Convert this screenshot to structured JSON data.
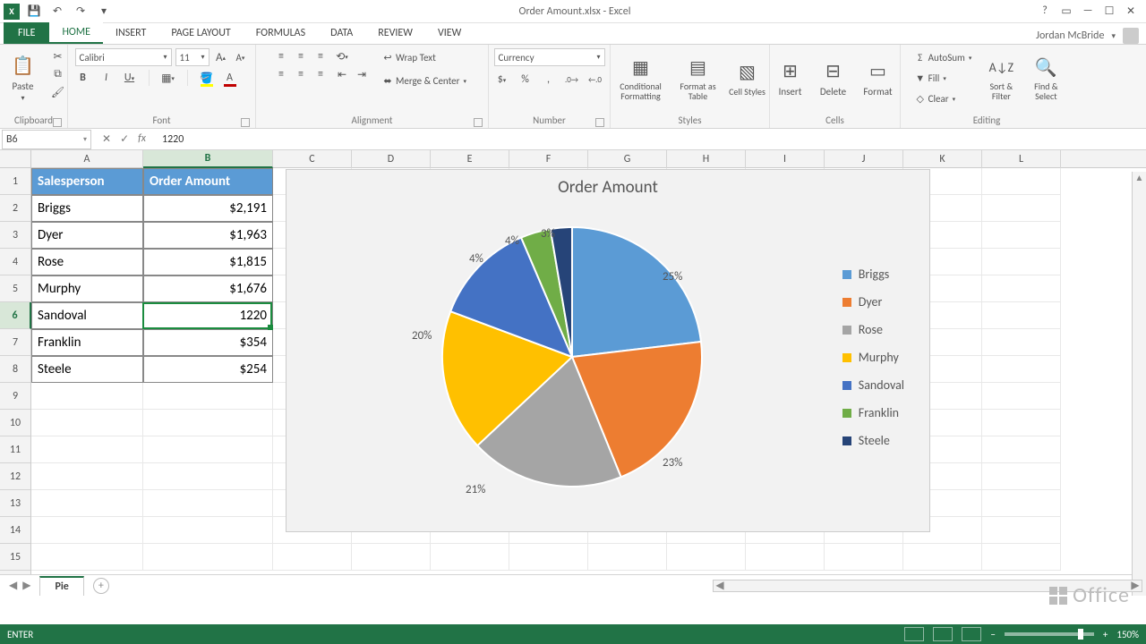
{
  "titlebar": {
    "title": "Order Amount.xlsx - Excel",
    "help": "?"
  },
  "user": {
    "name": "Jordan McBride"
  },
  "tabs": {
    "file": "FILE",
    "home": "HOME",
    "insert": "INSERT",
    "pagelayout": "PAGE LAYOUT",
    "formulas": "FORMULAS",
    "data": "DATA",
    "review": "REVIEW",
    "view": "VIEW"
  },
  "ribbon": {
    "clipboard": {
      "label": "Clipboard",
      "paste": "Paste"
    },
    "font": {
      "label": "Font",
      "name": "Calibri",
      "size": "11",
      "bold": "B",
      "italic": "I",
      "underline": "U"
    },
    "alignment": {
      "label": "Alignment",
      "wrap": "Wrap Text",
      "merge": "Merge & Center"
    },
    "number": {
      "label": "Number",
      "format": "Currency"
    },
    "styles": {
      "label": "Styles",
      "cond": "Conditional Formatting",
      "table": "Format as Table",
      "cell": "Cell Styles"
    },
    "cells": {
      "label": "Cells",
      "insert": "Insert",
      "delete": "Delete",
      "format": "Format"
    },
    "editing": {
      "label": "Editing",
      "autosum": "AutoSum",
      "fill": "Fill",
      "clear": "Clear",
      "sort": "Sort & Filter",
      "find": "Find & Select"
    }
  },
  "namebox": {
    "ref": "B6"
  },
  "formula": {
    "value": "1220"
  },
  "columns": [
    "A",
    "B",
    "C",
    "D",
    "E",
    "F",
    "G",
    "H",
    "I",
    "J",
    "K",
    "L"
  ],
  "rows": [
    "1",
    "2",
    "3",
    "4",
    "5",
    "6",
    "7",
    "8",
    "9",
    "10",
    "11",
    "12",
    "13",
    "14",
    "15"
  ],
  "table": {
    "headers": {
      "a": "Salesperson",
      "b": "Order Amount"
    },
    "rows": [
      {
        "name": "Briggs",
        "amount": "$2,191"
      },
      {
        "name": "Dyer",
        "amount": "$1,963"
      },
      {
        "name": "Rose",
        "amount": "$1,815"
      },
      {
        "name": "Murphy",
        "amount": "$1,676"
      },
      {
        "name": "Sandoval",
        "amount": "1220"
      },
      {
        "name": "Franklin",
        "amount": "$354"
      },
      {
        "name": "Steele",
        "amount": "$254"
      }
    ]
  },
  "chart": {
    "title": "Order Amount",
    "legend": [
      "Briggs",
      "Dyer",
      "Rose",
      "Murphy",
      "Sandoval",
      "Franklin",
      "Steele"
    ],
    "labels": [
      "25%",
      "23%",
      "21%",
      "20%",
      "4%",
      "4%",
      "3%"
    ]
  },
  "chart_data": {
    "type": "pie",
    "title": "Order Amount",
    "categories": [
      "Briggs",
      "Dyer",
      "Rose",
      "Murphy",
      "Sandoval",
      "Franklin",
      "Steele"
    ],
    "values": [
      2191,
      1963,
      1815,
      1676,
      1220,
      354,
      254
    ],
    "percent_labels": [
      "25%",
      "23%",
      "21%",
      "20%",
      "4%",
      "4%",
      "3%"
    ],
    "colors": [
      "#5b9bd5",
      "#ed7d31",
      "#a5a5a5",
      "#ffc000",
      "#4472c4",
      "#70ad47",
      "#264478"
    ]
  },
  "sheet": {
    "name": "Pie"
  },
  "status": {
    "mode": "ENTER",
    "zoom": "150%"
  },
  "branding": {
    "office": "Office"
  }
}
